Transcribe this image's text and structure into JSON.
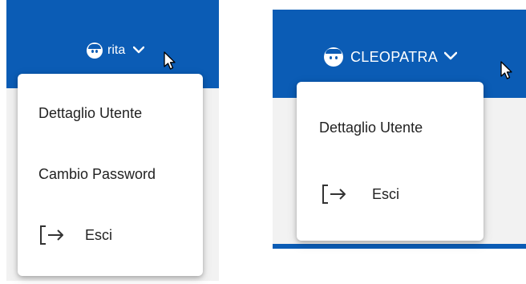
{
  "left": {
    "user": {
      "name": "rita"
    },
    "menu": {
      "items": [
        {
          "label": "Dettaglio Utente"
        },
        {
          "label": "Cambio Password"
        },
        {
          "label": "Esci",
          "icon": "logout-icon"
        }
      ]
    }
  },
  "right": {
    "user": {
      "name": "CLEOPATRA"
    },
    "menu": {
      "items": [
        {
          "label": "Dettaglio Utente"
        },
        {
          "label": "Esci",
          "icon": "logout-icon"
        }
      ]
    }
  },
  "colors": {
    "primary": "#0b5cb5",
    "menu_bg": "#ffffff",
    "text": "#222222"
  }
}
